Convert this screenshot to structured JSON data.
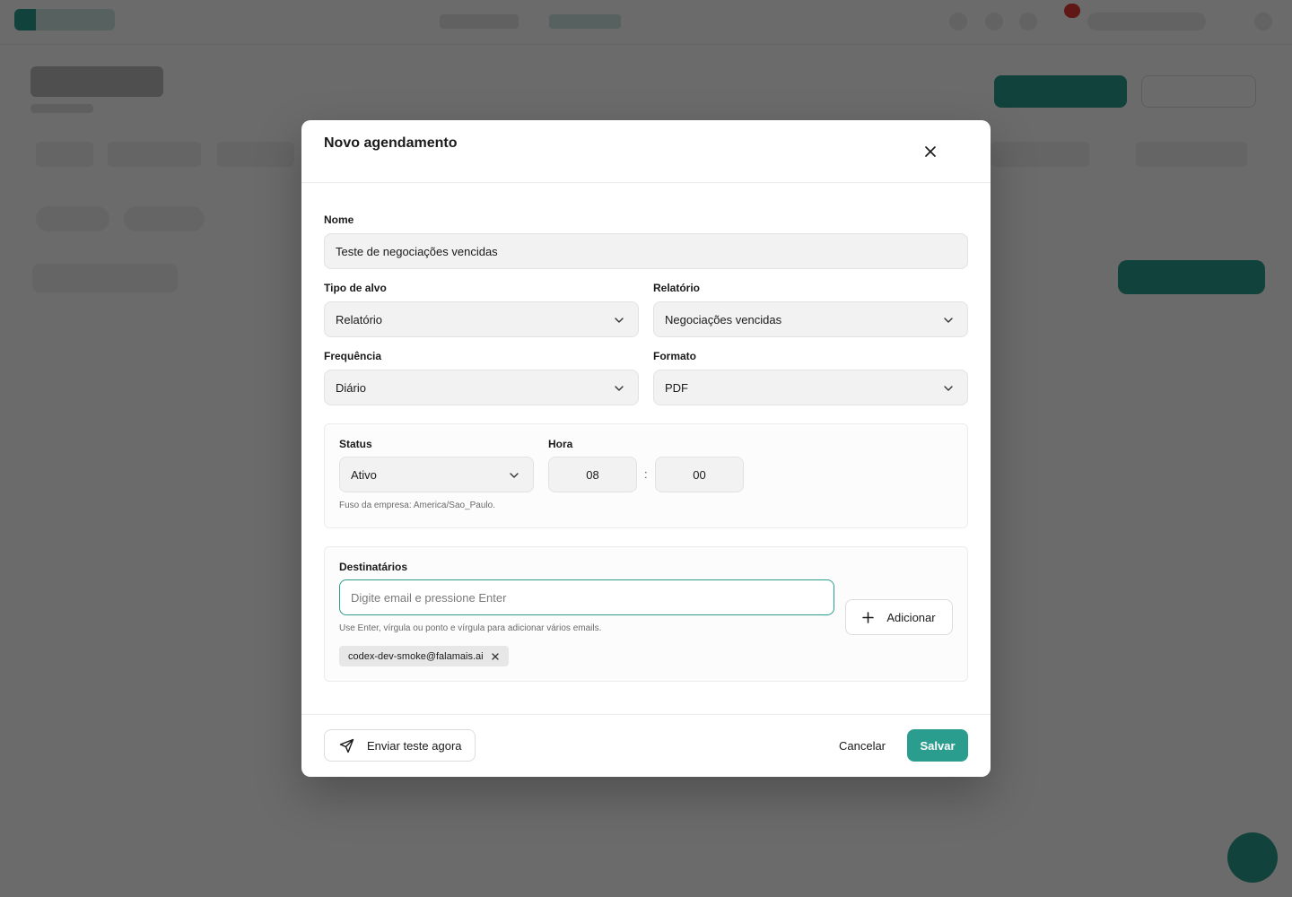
{
  "modal": {
    "title": "Novo agendamento",
    "close_icon": "close-icon"
  },
  "form": {
    "name": {
      "label": "Nome",
      "value": "Teste de negociações vencidas"
    },
    "target_type": {
      "label": "Tipo de alvo",
      "value": "Relatório"
    },
    "report": {
      "label": "Relatório",
      "value": "Negociações vencidas"
    },
    "frequency": {
      "label": "Frequência",
      "value": "Diário"
    },
    "format": {
      "label": "Formato",
      "value": "PDF"
    },
    "schedule": {
      "status": {
        "label": "Status",
        "value": "Ativo"
      },
      "time": {
        "label": "Hora",
        "hour": "08",
        "separator": ":",
        "minute": "00"
      },
      "timezone_hint": "Fuso da empresa: America/Sao_Paulo."
    },
    "recipients": {
      "label": "Destinatários",
      "placeholder": "Digite email e pressione Enter",
      "hint": "Use Enter, vírgula ou ponto e vírgula para adicionar vários emails.",
      "add_label": "Adicionar",
      "emails": [
        "codex-dev-smoke@falamais.ai"
      ]
    }
  },
  "footer": {
    "send_test_label": "Enviar teste agora",
    "cancel_label": "Cancelar",
    "save_label": "Salvar"
  },
  "colors": {
    "accent": "#2a9d8f",
    "overlay": "#000000"
  }
}
